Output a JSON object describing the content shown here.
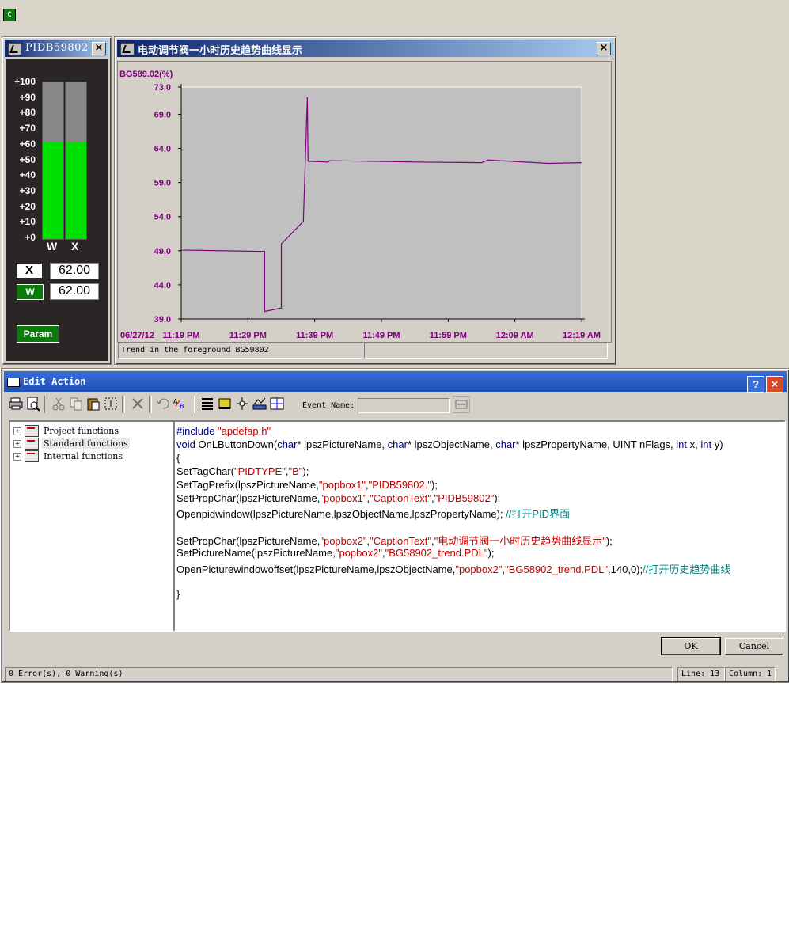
{
  "desktop": {
    "corner_icon_letter": "C"
  },
  "pid_window": {
    "title": "PIDB59802",
    "close": "×",
    "scale_labels": [
      "+100",
      "+90",
      "+80",
      "+70",
      "+60",
      "+50",
      "+40",
      "+30",
      "+20",
      "+10",
      "+0"
    ],
    "bars": [
      {
        "label": "W",
        "level_percent": 62
      },
      {
        "label": "X",
        "level_percent": 62
      }
    ],
    "x_tag": "X",
    "x_value": "62.00",
    "w_tag": "W",
    "w_value": "62.00",
    "param_label": "Param",
    "colors": {
      "bar_fill": "#00e000",
      "bar_empty": "#888888",
      "param_bg": "#0a7a0a"
    }
  },
  "trend_window": {
    "title": "电动调节阀一小时历史趋势曲线显示",
    "close": "×",
    "status_left": "Trend in the foreground BG59802",
    "status_right": ""
  },
  "chart_data": {
    "type": "line",
    "ylabel": "BG589.02(%)",
    "ylim": [
      39.0,
      73.0
    ],
    "y_ticks": [
      "73.0",
      "69.0",
      "64.0",
      "59.0",
      "54.0",
      "49.0",
      "44.0",
      "39.0"
    ],
    "y_tick_values": [
      73.0,
      69.0,
      64.0,
      59.0,
      54.0,
      49.0,
      44.0,
      39.0
    ],
    "date_label": "06/27/12",
    "x_ticks": [
      "11:19 PM",
      "11:29 PM",
      "11:39 PM",
      "11:49 PM",
      "11:59 PM",
      "12:09 AM",
      "12:19 AM"
    ],
    "x_range_min": [
      0,
      60
    ],
    "series": [
      {
        "color": "#800080",
        "x": [
          0,
          12.5,
          12.5,
          15.0,
          15.0,
          18.3,
          18.9,
          19.0,
          19.1,
          22.0,
          22.3,
          35.0,
          45.0,
          46.0,
          55.0,
          60.0
        ],
        "y": [
          49.1,
          48.9,
          40.1,
          40.6,
          50.0,
          53.3,
          71.5,
          62.2,
          62.1,
          62.0,
          62.2,
          62.0,
          61.9,
          62.3,
          61.8,
          61.9
        ]
      }
    ],
    "grid": false,
    "colors": {
      "axis_text": "#800080",
      "plot_bg": "#c0c0c0",
      "panel_bg": "#d4d0c8"
    }
  },
  "edit_action": {
    "title": "Edit Action",
    "help": "?",
    "close": "×",
    "event_name_label": "Event Name:",
    "event_name_value": "",
    "tree": [
      {
        "label": "Project functions"
      },
      {
        "label": "Standard functions"
      },
      {
        "label": "Internal functions"
      }
    ],
    "code": {
      "l1_a": "#include ",
      "l1_b": "\"apdefap.h\"",
      "l2_a": "void",
      "l2_b": " OnLButtonDown(",
      "l2_c": "char",
      "l2_d": "* lpszPictureName, ",
      "l2_e": "char",
      "l2_f": "* lpszObjectName, ",
      "l2_g": "char",
      "l2_h": "* lpszPropertyName, UINT nFlags, ",
      "l2_i": "int",
      "l2_j": " x, ",
      "l2_k": "int",
      "l2_l": " y)",
      "l3": "{",
      "l4_a": "SetTagChar(",
      "l4_b": "\"PIDTYPE\"",
      "l4_c": ",",
      "l4_d": "\"B\"",
      "l4_e": ");",
      "l5_a": "SetTagPrefix(lpszPictureName,",
      "l5_b": "\"popbox1\"",
      "l5_c": ",",
      "l5_d": "\"PIDB59802.\"",
      "l5_e": ");",
      "l6_a": "SetPropChar(lpszPictureName,",
      "l6_b": "\"popbox1\"",
      "l6_c": ",",
      "l6_d": "\"CaptionText\"",
      "l6_e": ",",
      "l6_f": "\"PIDB59802\"",
      "l6_g": ");",
      "l7_a": "Openpidwindow(lpszPictureName,lpszObjectName,lpszPropertyName); ",
      "l7_b": "//打开PID界面",
      "l9_a": "SetPropChar(lpszPictureName,",
      "l9_b": "\"popbox2\"",
      "l9_c": ",",
      "l9_d": "\"CaptionText\"",
      "l9_e": ",",
      "l9_f": "\"电动调节阀一小时历史趋势曲线显示\"",
      "l9_g": ");",
      "l10_a": "SetPictureName(lpszPictureName,",
      "l10_b": "\"popbox2\"",
      "l10_c": ",",
      "l10_d": "\"BG58902_trend.PDL\"",
      "l10_e": ");",
      "l11_a": "OpenPicturewindowoffset(lpszPictureName,lpszObjectName,",
      "l11_b": "\"popbox2\"",
      "l11_c": ",",
      "l11_d": "\"BG58902_trend.PDL\"",
      "l11_e": ",140,0);",
      "l11_f": "//打开历史趋势曲线",
      "l13": "}"
    },
    "ok_label": "OK",
    "cancel_label": "Cancel",
    "status_errors": "0 Error(s), 0 Warning(s)",
    "status_line": "Line: 13",
    "status_column": "Column: 1"
  }
}
